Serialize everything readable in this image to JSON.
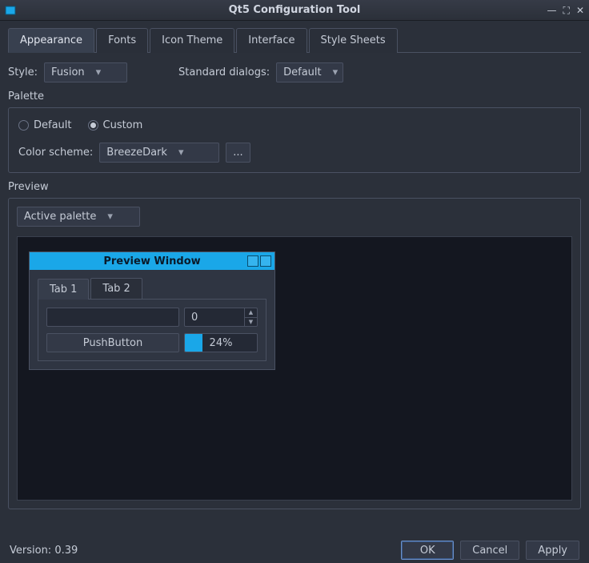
{
  "window": {
    "title": "Qt5 Configuration Tool"
  },
  "tabs": [
    "Appearance",
    "Fonts",
    "Icon Theme",
    "Interface",
    "Style Sheets"
  ],
  "active_tab_index": 0,
  "style": {
    "label": "Style:",
    "value": "Fusion"
  },
  "standard_dialogs": {
    "label": "Standard dialogs:",
    "value": "Default"
  },
  "palette": {
    "section_label": "Palette",
    "default_label": "Default",
    "custom_label": "Custom",
    "selected": "custom",
    "scheme_label": "Color scheme:",
    "scheme_value": "BreezeDark",
    "dots": "..."
  },
  "preview": {
    "section_label": "Preview",
    "palette_combo": "Active palette",
    "mini": {
      "title": "Preview Window",
      "tabs": [
        "Tab 1",
        "Tab 2"
      ],
      "active_tab_index": 0,
      "spin_value": "0",
      "button_label": "PushButton",
      "progress_pct": "24%",
      "progress_fill_width": "24%"
    }
  },
  "footer": {
    "version": "Version: 0.39",
    "ok": "OK",
    "cancel": "Cancel",
    "apply": "Apply"
  }
}
